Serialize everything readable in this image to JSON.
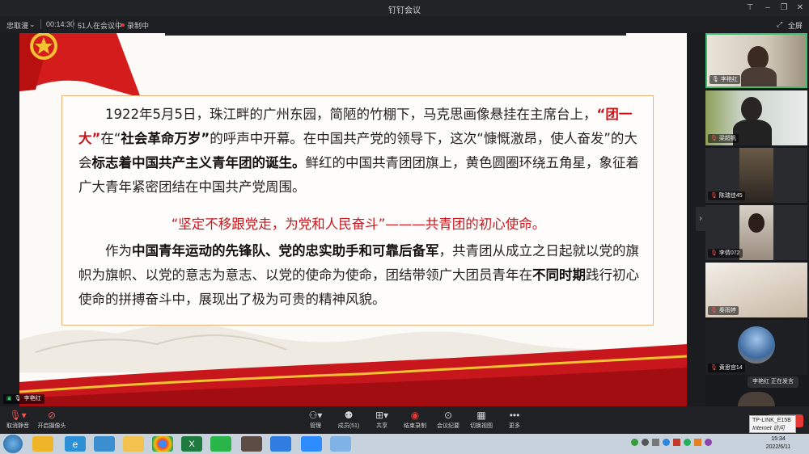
{
  "window": {
    "title": "钉钉会议"
  },
  "infobar": {
    "mode": "忠取漫",
    "duration": "00:14:30",
    "participants": "51人在会议中",
    "recording": "录制中",
    "fullscreen": "全屏"
  },
  "slide": {
    "p1_a": "1922年5月5日，珠江畔的广州东园，简陋的竹棚下，马克思画像悬挂在主席台上，",
    "p1_b": "“团",
    "p1_c": "一大”",
    "p1_d": "在“",
    "p1_e": "社会革命万岁”",
    "p1_f": "的呼声中开幕。在中国共产党的领导下，这次“慷慨激昂，使人奋",
    "p1_g": "发”的大会",
    "p1_h": "标志着中国共产主义青年团的诞生。",
    "p1_i": "鲜红的中国共青团团旗上，黄色圆圈环绕五角",
    "p1_j": "星，象征着广大青年紧密团结在中国共产党周围。",
    "slogan": "“坚定不移跟党走，为党和人民奋斗”———共青团的初心使命。",
    "p2_a": "作为",
    "p2_b": "中国青年运动的先锋队、党的忠实助手和可靠后备军",
    "p2_c": "，共青团从成立之日起就以党",
    "p2_d": "的旗帜为旗帜、以党的意志为意志、以党的使命为使命，团结带领广大团员青年在",
    "p2_e": "不同时期",
    "p2_f": "践",
    "p2_g": "行初心使命的拼搏奋斗中，展现出了极为可贵的精神风貌。"
  },
  "presenter": {
    "name": "李艳红"
  },
  "toolbar": {
    "mute": "取消静音",
    "camera": "开启摄像头",
    "manage": "管理",
    "members": "成员(51)",
    "share": "共享",
    "record": "结束录制",
    "minutes": "会议纪要",
    "view": "切换视图",
    "more": "更多"
  },
  "participants": [
    {
      "name": "李艳红"
    },
    {
      "name": "梁超帆"
    },
    {
      "name": "陈瑞佳45"
    },
    {
      "name": "李倩072"
    },
    {
      "name": "秦雨婷"
    },
    {
      "name": "黄思宫14"
    }
  ],
  "speaking": "李艳红  正在发言",
  "network_popup": {
    "line1": "TP-LINK_E15B",
    "line2": "Internet 访问"
  },
  "clock": {
    "time": "15:34",
    "date": "2022/6/11"
  },
  "colors": {
    "accent_red": "#c8161d",
    "highlight_border": "#f0b27a",
    "active_tile_border": "#3fbf6f"
  }
}
